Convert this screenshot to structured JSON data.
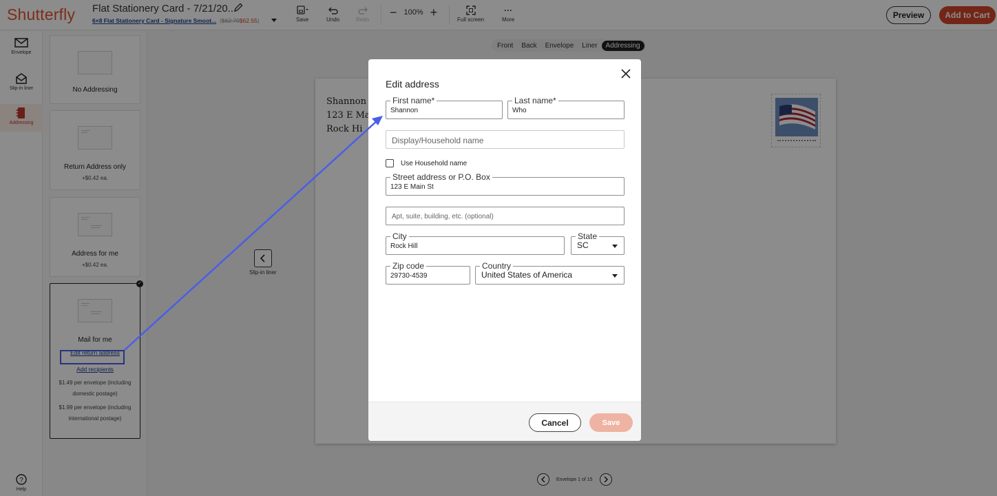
{
  "header": {
    "logo": "Shutterfly",
    "doc_title": "Flat Stationery Card - 7/21/20...",
    "product_link": "6×8 Flat Stationery Card - Signature Smoot...",
    "price_open": "(",
    "old_price": "$62.70",
    "new_price": "$62.55",
    "price_close": ")",
    "tools": {
      "save": "Save",
      "undo": "Undo",
      "redo": "Redo",
      "zoom": "100%",
      "fullscreen": "Full screen",
      "more": "More"
    },
    "preview_label": "Preview",
    "add_to_cart_label": "Add to Cart"
  },
  "rail": {
    "items": [
      {
        "label": "Envelope",
        "icon": "envelope-icon"
      },
      {
        "label": "Slip-in liner",
        "icon": "open-envelope-icon"
      },
      {
        "label": "Addressing",
        "icon": "address-book-icon"
      }
    ],
    "help": "Help"
  },
  "options": {
    "no_addressing": "No Addressing",
    "return_only": {
      "title": "Return Address only",
      "price": "+$0.42 ea."
    },
    "address_for_me": {
      "title": "Address for me",
      "price": "+$0.42 ea."
    },
    "mail_for_me": {
      "title": "Mail for me",
      "edit_link": "Edit return address",
      "add_link": "Add recipients",
      "domestic_1": "$1.49 per envelope (including",
      "domestic_2": "domestic postage)",
      "intl_1": "$1.99 per envelope (including",
      "intl_2": "international postage)"
    }
  },
  "view_tabs": [
    "Front",
    "Back",
    "Envelope",
    "Liner",
    "Addressing"
  ],
  "envelope_preview": {
    "line1": "Shannon",
    "line2": "123 E Ma",
    "line3": "Rock Hi"
  },
  "slip_nav_label": "Slip-in liner",
  "pager_label": "Envelope 1 of 15",
  "modal": {
    "title": "Edit address",
    "first_name": {
      "label": "First name*",
      "value": "Shannon"
    },
    "last_name": {
      "label": "Last name*",
      "value": "Who"
    },
    "display_name_placeholder": "Display/Household name",
    "household_checkbox": "Use Household name",
    "street": {
      "label": "Street address or P.O. Box",
      "value": "123 E Main St"
    },
    "apt_placeholder": "Apt, suite, building, etc. (optional)",
    "city": {
      "label": "City",
      "value": "Rock Hill"
    },
    "state": {
      "label": "State",
      "value": "SC"
    },
    "zip": {
      "label": "Zip code",
      "value": "29730-4539"
    },
    "country": {
      "label": "Country",
      "value": "United States of America"
    },
    "cancel": "Cancel",
    "save": "Save"
  },
  "colors": {
    "brand": "#e2542c",
    "accent_red": "#d2452a",
    "annotation_blue": "#4a5ee8",
    "save_disabled": "#eeb3a2"
  }
}
